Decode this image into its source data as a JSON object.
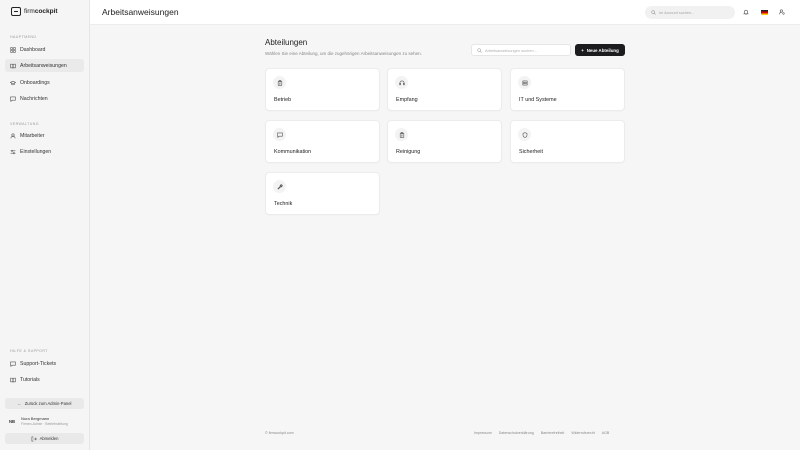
{
  "brand": {
    "name_bold": "firm",
    "name_light": "cockpit"
  },
  "sidebar": {
    "section_main": "Hauptmenü",
    "main_items": [
      {
        "label": "Dashboard",
        "icon": "grid-icon"
      },
      {
        "label": "Arbeitsanweisungen",
        "icon": "book-icon",
        "active": true
      },
      {
        "label": "Onboardings",
        "icon": "graduation-icon"
      },
      {
        "label": "Nachrichten",
        "icon": "message-icon"
      }
    ],
    "section_admin": "Verwaltung",
    "admin_items": [
      {
        "label": "Mitarbeiter",
        "icon": "user-icon"
      },
      {
        "label": "Einstellungen",
        "icon": "sliders-icon"
      }
    ],
    "section_help": "Hilfe & Support",
    "help_items": [
      {
        "label": "Support-Tickets",
        "icon": "message-icon"
      },
      {
        "label": "Tutorials",
        "icon": "book-icon"
      }
    ],
    "back_label": "Zurück zum Admin-Panel",
    "user": {
      "initials": "NB",
      "name": "Nora Bergmann",
      "role": "Firmen-Admin · Betriebsleitung"
    },
    "logout_label": "Abmelden"
  },
  "header": {
    "title": "Arbeitsanweisungen",
    "search_placeholder": "Im Account suchen..."
  },
  "main": {
    "heading": "Abteilungen",
    "subheading": "Wählen Sie eine Abteilung, um die zugehörigen Arbeitsanweisungen zu sehen.",
    "search_placeholder": "Arbeitsanweisungen suchen...",
    "new_button": "Neue Abteilung",
    "departments": [
      {
        "label": "Betrieb",
        "icon": "clipboard-icon"
      },
      {
        "label": "Empfang",
        "icon": "headset-icon"
      },
      {
        "label": "IT und Systeme",
        "icon": "server-icon"
      },
      {
        "label": "Kommunikation",
        "icon": "message-icon"
      },
      {
        "label": "Reinigung",
        "icon": "clipboard-icon"
      },
      {
        "label": "Sicherheit",
        "icon": "shield-icon"
      },
      {
        "label": "Technik",
        "icon": "wrench-icon"
      }
    ]
  },
  "footer": {
    "copyright": "© firmcockpit.com",
    "links": [
      "Impressum",
      "Datenschutzerklärung",
      "Barrierefreiheit",
      "Widerrufsrecht",
      "AGB"
    ]
  },
  "colors": {
    "primary_button": "#1c1c1e",
    "sidebar_bg": "#f5f5f5",
    "page_bg": "#f6f6f6"
  }
}
